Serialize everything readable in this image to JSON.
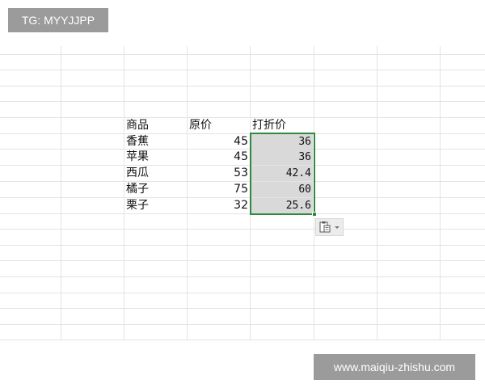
{
  "watermarks": {
    "top_left": "TG: MYYJJPP",
    "bottom_right": "www.maiqiu-zhishu.com"
  },
  "table": {
    "headers": [
      "商品",
      "原价",
      "打折价"
    ],
    "rows": [
      {
        "item": "香蕉",
        "original": "45",
        "discount": "36"
      },
      {
        "item": "苹果",
        "original": "45",
        "discount": "36"
      },
      {
        "item": "西瓜",
        "original": "53",
        "discount": "42.4"
      },
      {
        "item": "橘子",
        "original": "75",
        "discount": "60"
      },
      {
        "item": "栗子",
        "original": "32",
        "discount": "25.6"
      }
    ]
  },
  "colors": {
    "selection_border": "#2e8b3e",
    "selection_fill": "#d9d9d9",
    "watermark_bg": "#9b9b9b"
  },
  "icons": {
    "paste_options": "paste-options-icon",
    "dropdown": "chevron-down-icon"
  }
}
